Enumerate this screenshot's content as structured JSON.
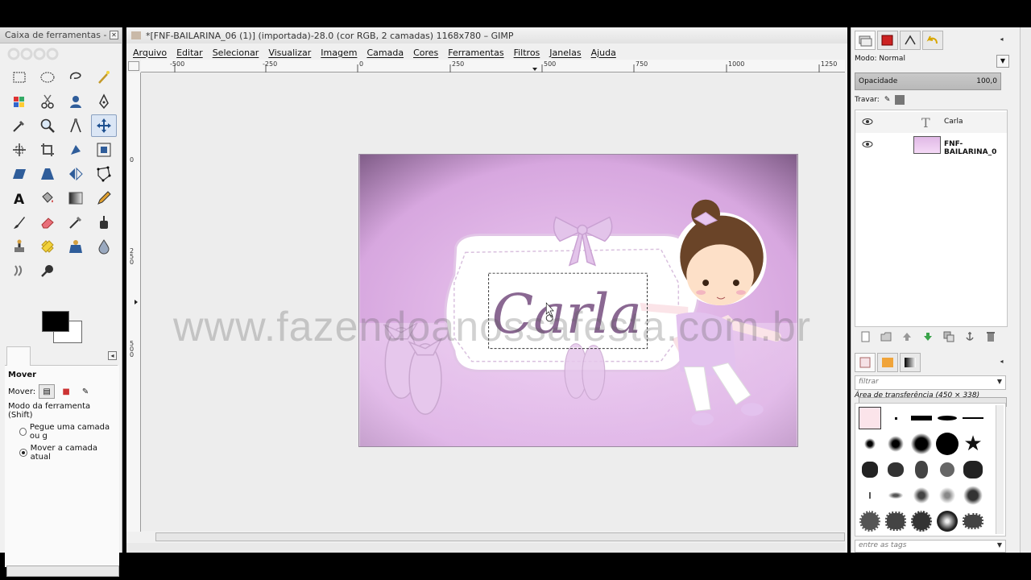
{
  "toolbox": {
    "title": "Caixa de ferramentas - O...",
    "tools": [
      "rect-select",
      "ellipse-select",
      "free-select",
      "fuzzy-select",
      "color-select",
      "scissors",
      "foreground-select",
      "paths",
      "color-picker",
      "zoom",
      "measure",
      "move",
      "align",
      "crop",
      "rotate",
      "scale",
      "shear",
      "perspective",
      "flip",
      "cage",
      "text",
      "bucket-fill",
      "blend",
      "pencil",
      "paintbrush",
      "eraser",
      "airbrush",
      "ink",
      "clone",
      "heal",
      "perspective-clone",
      "blur",
      "smudge",
      "dodge-burn"
    ],
    "options_title": "Mover",
    "move_label": "Mover:",
    "mode_label": "Modo da ferramenta (Shift)",
    "radio1": "Pegue uma camada ou g",
    "radio2": "Mover a camada atual",
    "fg_color": "#000000",
    "bg_color": "#ffffff"
  },
  "image_window": {
    "title": "*[FNF-BAILARINA_06 (1)] (importada)-28.0 (cor RGB, 2 camadas) 1168x780 – GIMP",
    "menu": [
      "Arquivo",
      "Editar",
      "Selecionar",
      "Visualizar",
      "Imagem",
      "Camada",
      "Cores",
      "Ferramentas",
      "Filtros",
      "Janelas",
      "Ajuda"
    ],
    "ruler_labels": [
      "-500",
      "-250",
      "0",
      "250",
      "500",
      "750",
      "1000",
      "1250"
    ],
    "vruler_labels": [
      "0",
      "2\n5\n0",
      "5\n0\n0"
    ],
    "text_layer": "Carla",
    "watermark": "www.fazendoanossafesta.com.br"
  },
  "dock": {
    "mode_label": "Modo: Normal",
    "opacity_label": "Opacidade",
    "opacity_value": "100,0",
    "lock_label": "Travar:",
    "layers": [
      {
        "name": "Carla",
        "type": "text"
      },
      {
        "name": "FNF-BAILARINA_0",
        "type": "image"
      }
    ],
    "filter_placeholder": "filtrar",
    "clipboard_label": "Área de transferência (450 × 338)",
    "tags_placeholder": "entre as tags"
  }
}
